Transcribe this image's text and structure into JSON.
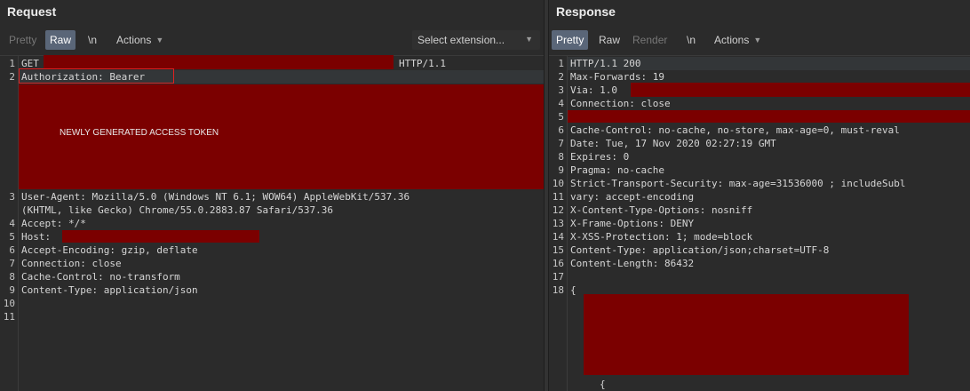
{
  "request": {
    "title": "Request",
    "tabs": {
      "pretty": "Pretty",
      "raw": "Raw",
      "newline": "\\n",
      "actions": "Actions"
    },
    "select_extension": "Select extension...",
    "line_numbers": [
      "1",
      "2",
      "3",
      "4",
      "5",
      "6",
      "7",
      "8",
      "9",
      "10",
      "11"
    ],
    "lines": {
      "l1_method": "GET",
      "l1_version": "HTTP/1.1",
      "l2": "Authorization: Bearer",
      "token_label": "NEWLY GENERATED ACCESS TOKEN",
      "l3a": "User-Agent: Mozilla/5.0 (Windows NT 6.1; WOW64) AppleWebKit/537.36",
      "l3b": "(KHTML, like Gecko) Chrome/55.0.2883.87 Safari/537.36",
      "l4": "Accept: */*",
      "l5": "Host:",
      "l6": "Accept-Encoding: gzip, deflate",
      "l7": "Connection: close",
      "l8": "Cache-Control: no-transform",
      "l9": "Content-Type: application/json"
    }
  },
  "response": {
    "title": "Response",
    "tabs": {
      "pretty": "Pretty",
      "raw": "Raw",
      "render": "Render",
      "newline": "\\n",
      "actions": "Actions"
    },
    "line_numbers": [
      "1",
      "2",
      "3",
      "4",
      "5",
      "6",
      "7",
      "8",
      "9",
      "10",
      "11",
      "12",
      "13",
      "14",
      "15",
      "16",
      "17",
      "18"
    ],
    "lines": {
      "l1": "HTTP/1.1 200",
      "l2": "Max-Forwards: 19",
      "l3": "Via: 1.0",
      "l4": "Connection: close",
      "l6": "Cache-Control: no-cache, no-store, max-age=0, must-reval",
      "l7": "Date: Tue, 17 Nov 2020 02:27:19 GMT",
      "l8": "Expires: 0",
      "l9": "Pragma: no-cache",
      "l10": "Strict-Transport-Security: max-age=31536000 ; includeSubl",
      "l11": "vary: accept-encoding",
      "l12": "X-Content-Type-Options: nosniff",
      "l13": "X-Frame-Options: DENY",
      "l14": "X-XSS-Protection: 1; mode=block",
      "l15": "Content-Type: application/json;charset=UTF-8",
      "l16": "Content-Length: 86432",
      "l18": "{",
      "l19": "{"
    }
  },
  "colors": {
    "background": "#2b2b2b",
    "redaction": "#7b0000",
    "active_tab": "#5a6678",
    "highlight_box": "#e02020"
  }
}
